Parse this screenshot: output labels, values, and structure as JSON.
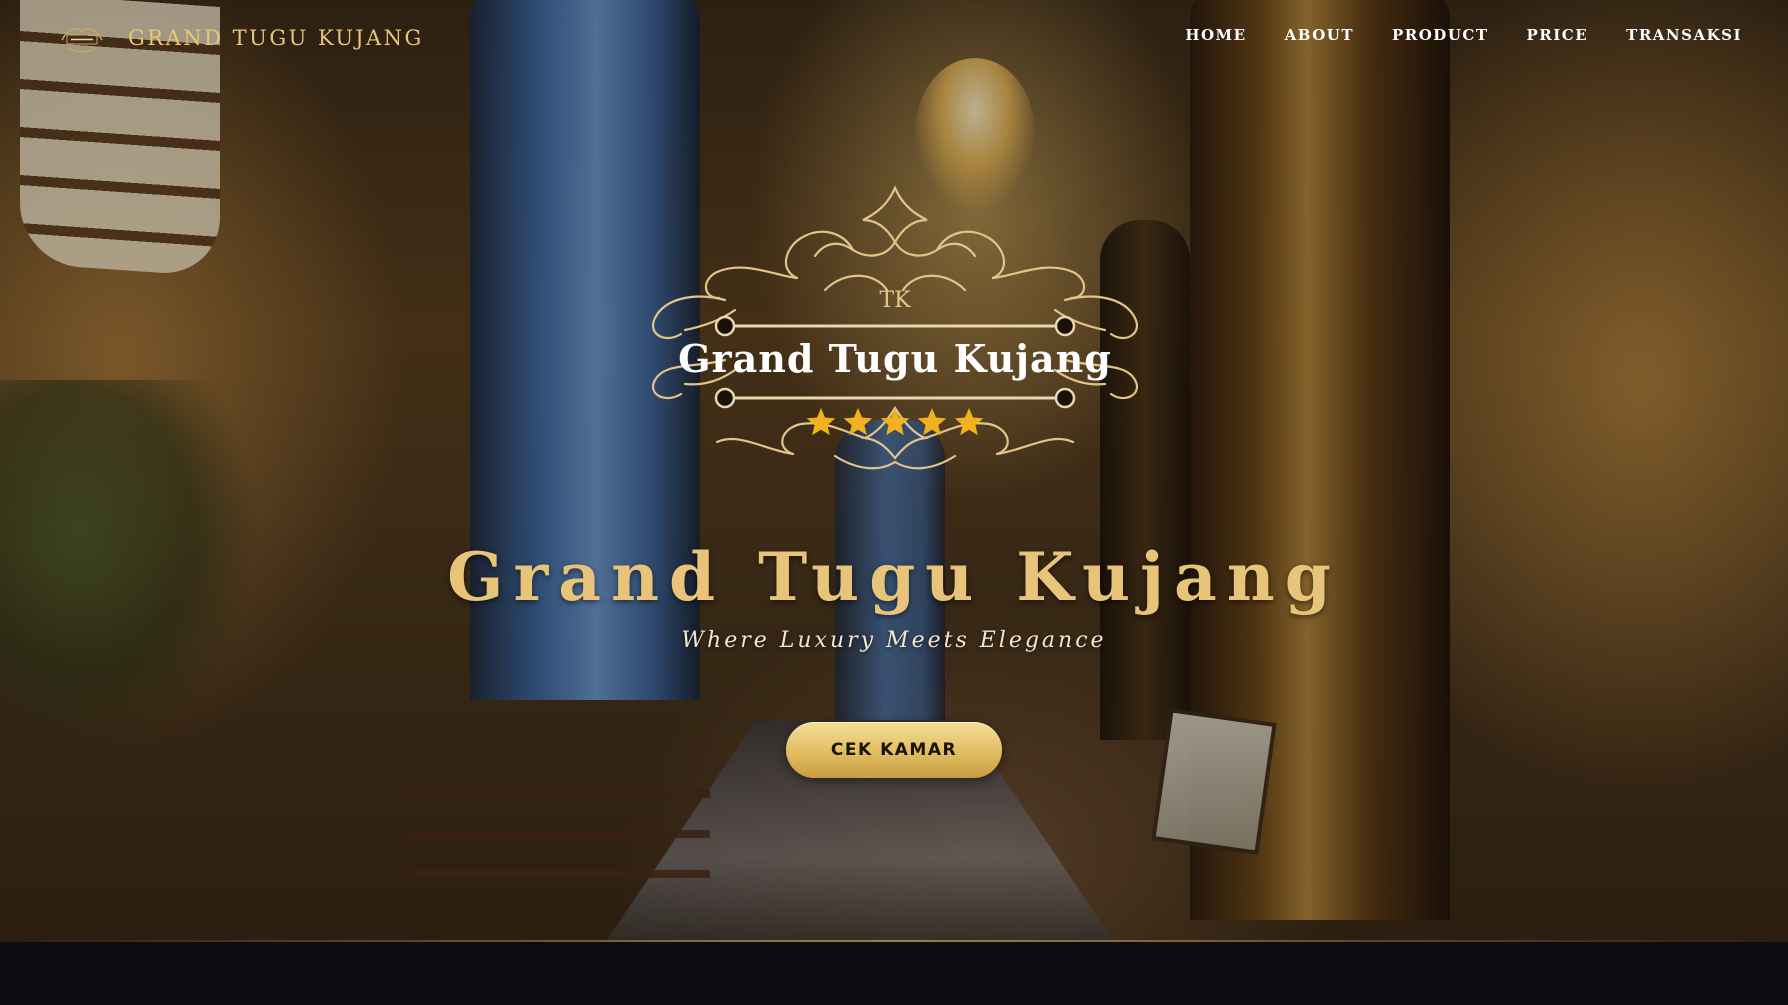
{
  "navbar": {
    "brand_name": "GRAND TUGU KUJANG",
    "links": [
      "HOME",
      "ABOUT",
      "PRODUCT",
      "PRICE",
      "TRANSAKSI"
    ]
  },
  "hero": {
    "emblem": {
      "monogram": "TK",
      "name": "Grand Tugu Kujang",
      "star_count": 5
    },
    "title": "Grand Tugu Kujang",
    "tagline": "Where Luxury Meets Elegance",
    "cta_label": "CEK KAMAR"
  },
  "colors": {
    "gold": "#e7c47a",
    "button_gold": "#e0bd62",
    "star": "#f2b21e",
    "footer": "#0c0d10"
  }
}
